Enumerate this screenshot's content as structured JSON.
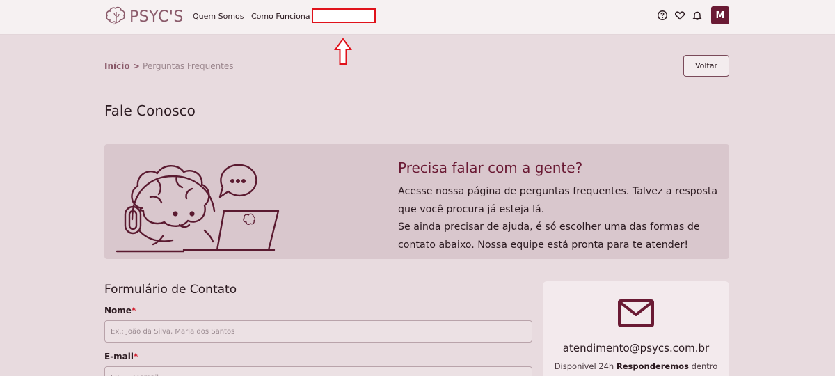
{
  "header": {
    "logo_text": "PSYC'S",
    "nav": [
      "Quem Somos",
      "Como Funciona"
    ],
    "avatar_initial": "M",
    "icons": [
      "help-circle-icon",
      "heart-icon",
      "bell-icon"
    ]
  },
  "breadcrumb": {
    "home": "Início",
    "separator": " > ",
    "current": "Perguntas Frequentes"
  },
  "back_button": "Voltar",
  "page_title": "Fale Conosco",
  "banner": {
    "heading": "Precisa falar com a gente?",
    "line1": "Acesse nossa página de perguntas frequentes. Talvez a resposta que você procura já esteja lá.",
    "line2": "Se ainda precisar de ajuda, é só escolher uma das formas de contato abaixo. Nossa equipe está pronta para te atender!"
  },
  "form": {
    "title": "Formulário de Contato",
    "name_label": "Nome",
    "name_placeholder": "Ex.: João da Silva, Maria dos Santos",
    "email_label": "E-mail",
    "email_placeholder": "Ex.: ...@email...",
    "required_mark": "*"
  },
  "contact_card": {
    "email": "atendimento@psycs.com.br",
    "availability_prefix": "Disponível 24h ",
    "availability_bold": "Responderemos",
    "availability_suffix": " dentro"
  },
  "colors": {
    "brand": "#6a1a34",
    "page_bg": "#e8dbdf",
    "banner_bg": "#d9c7cd",
    "annotation_red": "#e0121b"
  }
}
